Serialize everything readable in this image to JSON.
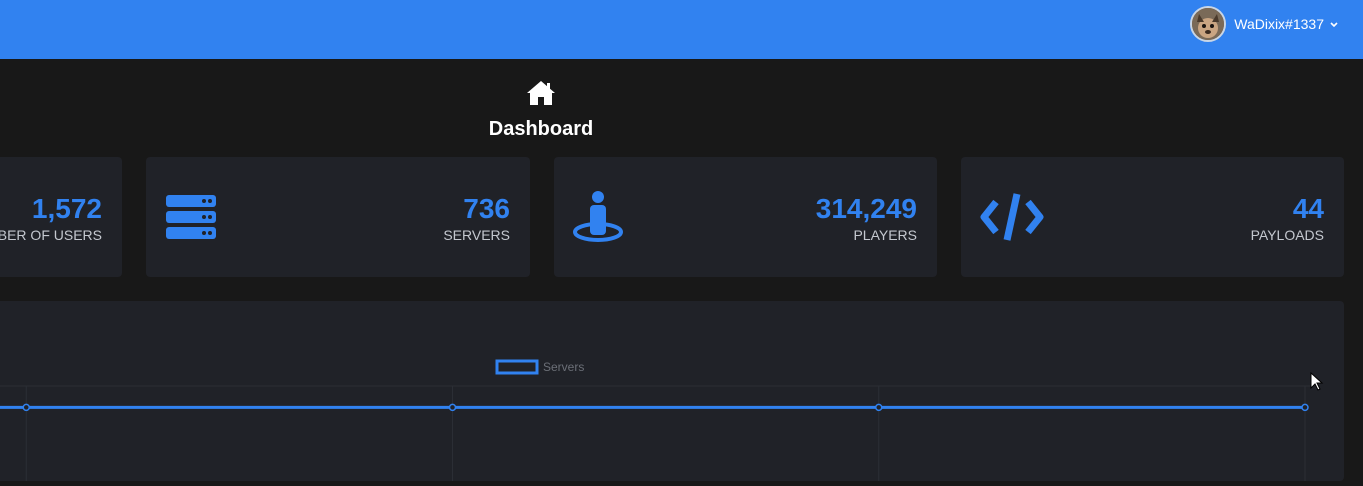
{
  "header": {
    "username": "WaDixix#1337",
    "caret_icon": "chevron-down-icon",
    "accent": "#3182f0"
  },
  "page": {
    "title": "Dashboard",
    "icon": "home-icon"
  },
  "stats": [
    {
      "value": "1,572",
      "label": "NUMBER OF USERS",
      "icon": "users-icon"
    },
    {
      "value": "736",
      "label": "SERVERS",
      "icon": "server-icon"
    },
    {
      "value": "314,249",
      "label": "PLAYERS",
      "icon": "player-icon"
    },
    {
      "value": "44",
      "label": "PAYLOADS",
      "icon": "code-icon"
    }
  ],
  "chart_data": {
    "type": "line",
    "series": [
      {
        "name": "Servers",
        "values": [
          736,
          736,
          736,
          736,
          736
        ]
      }
    ],
    "grid": true,
    "legend": "top-center",
    "color": "#3182f0"
  }
}
